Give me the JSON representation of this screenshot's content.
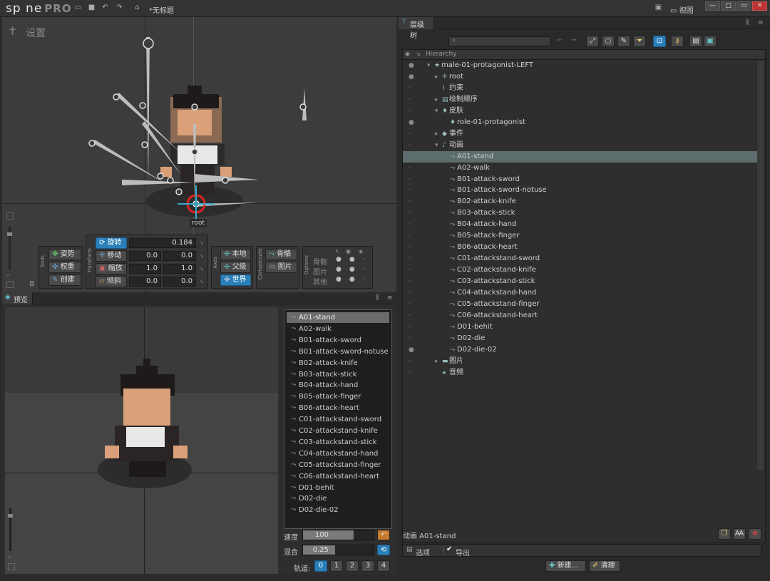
{
  "titlebar": {
    "logo_main": "sp ne",
    "logo_pro": "PRO",
    "doc_title": "*无标题",
    "view_label": "视图",
    "icons": [
      "folder-icon",
      "save-icon",
      "undo-icon",
      "redo-icon",
      "export-icon"
    ]
  },
  "viewport": {
    "settings_label": "设置",
    "root_label": "root",
    "tools": {
      "group_label": "Tools",
      "pose": "姿势",
      "weights": "权重",
      "create": "创建"
    },
    "transform": {
      "group_label": "Transform",
      "rotate": "旋转",
      "rotate_val": "0.184",
      "translate": "移动",
      "tx": "0.0",
      "ty": "0.0",
      "scale": "缩放",
      "sx": "1.0",
      "sy": "1.0",
      "shear": "倾斜",
      "shx": "0.0",
      "shy": "0.0"
    },
    "axes": {
      "group_label": "Axes",
      "local": "本地",
      "parent": "父级",
      "world": "世界"
    },
    "compensate": {
      "group_label": "Compensate",
      "bones": "骨骼",
      "images": "图片"
    },
    "options": {
      "group_label": "Options",
      "bones": "骨骼",
      "images": "图片",
      "others": "其他"
    }
  },
  "preview": {
    "tab_label": "预览",
    "animations": [
      "A01-stand",
      "A02-walk",
      "B01-attack-sword",
      "B01-attack-sword-notuse",
      "B02-attack-knife",
      "B03-attack-stick",
      "B04-attack-hand",
      "B05-attack-finger",
      "B06-attack-heart",
      "C01-attackstand-sword",
      "C02-attackstand-knife",
      "C03-attackstand-stick",
      "C04-attackstand-hand",
      "C05-attackstand-finger",
      "C06-attackstand-heart",
      "D01-behit",
      "D02-die",
      "D02-die-02"
    ],
    "speed_label": "速度",
    "speed_value": "100",
    "speed_fill": 0.72,
    "mix_label": "混合",
    "mix_value": "0.25",
    "mix_fill": 0.45,
    "track_label": "轨道:",
    "tracks": [
      "0",
      "1",
      "2",
      "3",
      "4"
    ]
  },
  "hierarchy": {
    "tab_label": "层级树",
    "col_label": "Hierarchy",
    "rows": [
      {
        "label": "male-01-protagonist-LEFT",
        "indent": 0,
        "arrow": "▾",
        "icon": "★",
        "dot": true
      },
      {
        "label": "root",
        "indent": 1,
        "arrow": "▸",
        "icon": "✛",
        "dot": true
      },
      {
        "label": "约束",
        "indent": 1,
        "arrow": "",
        "icon": "⌇",
        "dot": false
      },
      {
        "label": "绘制顺序",
        "indent": 1,
        "arrow": "▸",
        "icon": "▤",
        "dot": false
      },
      {
        "label": "皮肤",
        "indent": 1,
        "arrow": "▾",
        "icon": "♦",
        "dot": false
      },
      {
        "label": "role-01-protagonist",
        "indent": 2,
        "arrow": "",
        "icon": "♦",
        "dot": true
      },
      {
        "label": "事件",
        "indent": 1,
        "arrow": "▸",
        "icon": "◆",
        "dot": false
      },
      {
        "label": "动画",
        "indent": 1,
        "arrow": "▾",
        "icon": "♪",
        "dot": false
      },
      {
        "label": "A01-stand",
        "indent": 2,
        "arrow": "",
        "icon": "⤳",
        "dot": false,
        "sel": true
      },
      {
        "label": "A02-walk",
        "indent": 2,
        "arrow": "",
        "icon": "⤳",
        "dot": false
      },
      {
        "label": "B01-attack-sword",
        "indent": 2,
        "arrow": "",
        "icon": "⤳",
        "dot": false
      },
      {
        "label": "B01-attack-sword-notuse",
        "indent": 2,
        "arrow": "",
        "icon": "⤳",
        "dot": false
      },
      {
        "label": "B02-attack-knife",
        "indent": 2,
        "arrow": "",
        "icon": "⤳",
        "dot": false
      },
      {
        "label": "B03-attack-stick",
        "indent": 2,
        "arrow": "",
        "icon": "⤳",
        "dot": false
      },
      {
        "label": "B04-attack-hand",
        "indent": 2,
        "arrow": "",
        "icon": "⤳",
        "dot": false
      },
      {
        "label": "B05-attack-finger",
        "indent": 2,
        "arrow": "",
        "icon": "⤳",
        "dot": false
      },
      {
        "label": "B06-attack-heart",
        "indent": 2,
        "arrow": "",
        "icon": "⤳",
        "dot": false
      },
      {
        "label": "C01-attackstand-sword",
        "indent": 2,
        "arrow": "",
        "icon": "⤳",
        "dot": false
      },
      {
        "label": "C02-attackstand-knife",
        "indent": 2,
        "arrow": "",
        "icon": "⤳",
        "dot": false
      },
      {
        "label": "C03-attackstand-stick",
        "indent": 2,
        "arrow": "",
        "icon": "⤳",
        "dot": false
      },
      {
        "label": "C04-attackstand-hand",
        "indent": 2,
        "arrow": "",
        "icon": "⤳",
        "dot": false
      },
      {
        "label": "C05-attackstand-finger",
        "indent": 2,
        "arrow": "",
        "icon": "⤳",
        "dot": false
      },
      {
        "label": "C06-attackstand-heart",
        "indent": 2,
        "arrow": "",
        "icon": "⤳",
        "dot": false
      },
      {
        "label": "D01-behit",
        "indent": 2,
        "arrow": "",
        "icon": "⤳",
        "dot": false
      },
      {
        "label": "D02-die",
        "indent": 2,
        "arrow": "",
        "icon": "⤳",
        "dot": false
      },
      {
        "label": "D02-die-02",
        "indent": 2,
        "arrow": "",
        "icon": "⤳",
        "dot": true
      },
      {
        "label": "图片",
        "indent": 1,
        "arrow": "▸",
        "icon": "▬",
        "dot": false
      },
      {
        "label": "音频",
        "indent": 1,
        "arrow": "",
        "icon": "◂",
        "dot": false
      }
    ],
    "status_text": "动画 A01-stand",
    "options_label": "选项",
    "export_label": "导出",
    "new_label": "新建...",
    "clean_label": "清理"
  },
  "colors": {
    "accent": "#2a7fb8",
    "selection": "#5d6c6c",
    "close": "#cc3333"
  }
}
